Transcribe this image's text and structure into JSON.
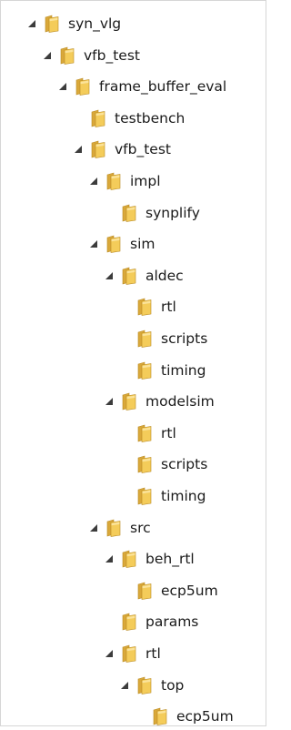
{
  "tree": {
    "nodes": [
      {
        "label": "syn_vlg",
        "level": 0,
        "expanded": true,
        "icon": "folder-icon"
      },
      {
        "label": "vfb_test",
        "level": 1,
        "expanded": true,
        "icon": "folder-icon"
      },
      {
        "label": "frame_buffer_eval",
        "level": 2,
        "expanded": true,
        "icon": "folder-icon"
      },
      {
        "label": "testbench",
        "level": 3,
        "expanded": null,
        "icon": "folder-icon"
      },
      {
        "label": "vfb_test",
        "level": 3,
        "expanded": true,
        "icon": "folder-icon"
      },
      {
        "label": "impl",
        "level": 4,
        "expanded": true,
        "icon": "folder-icon"
      },
      {
        "label": "synplify",
        "level": 5,
        "expanded": null,
        "icon": "folder-icon"
      },
      {
        "label": "sim",
        "level": 4,
        "expanded": true,
        "icon": "folder-icon"
      },
      {
        "label": "aldec",
        "level": 5,
        "expanded": true,
        "icon": "folder-icon"
      },
      {
        "label": "rtl",
        "level": 6,
        "expanded": null,
        "icon": "folder-icon"
      },
      {
        "label": "scripts",
        "level": 6,
        "expanded": null,
        "icon": "folder-icon"
      },
      {
        "label": "timing",
        "level": 6,
        "expanded": null,
        "icon": "folder-icon"
      },
      {
        "label": "modelsim",
        "level": 5,
        "expanded": true,
        "icon": "folder-icon"
      },
      {
        "label": "rtl",
        "level": 6,
        "expanded": null,
        "icon": "folder-icon"
      },
      {
        "label": "scripts",
        "level": 6,
        "expanded": null,
        "icon": "folder-icon"
      },
      {
        "label": "timing",
        "level": 6,
        "expanded": null,
        "icon": "folder-icon"
      },
      {
        "label": "src",
        "level": 4,
        "expanded": true,
        "icon": "folder-icon"
      },
      {
        "label": "beh_rtl",
        "level": 5,
        "expanded": true,
        "icon": "folder-icon"
      },
      {
        "label": "ecp5um",
        "level": 6,
        "expanded": null,
        "icon": "folder-icon"
      },
      {
        "label": "params",
        "level": 5,
        "expanded": null,
        "icon": "folder-icon"
      },
      {
        "label": "rtl",
        "level": 5,
        "expanded": true,
        "icon": "folder-icon"
      },
      {
        "label": "top",
        "level": 6,
        "expanded": true,
        "icon": "folder-icon"
      },
      {
        "label": "ecp5um",
        "level": 7,
        "expanded": null,
        "icon": "folder-icon"
      }
    ]
  },
  "colors": {
    "expander": "#3c3c3c",
    "folder_back": "#d9a83a",
    "folder_front": "#f4cc5a",
    "folder_edge": "#b98a22",
    "text": "#1a1a1a"
  }
}
